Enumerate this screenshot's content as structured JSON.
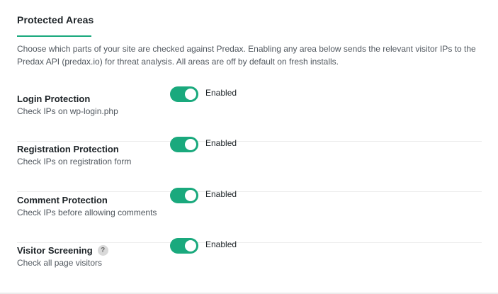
{
  "section": {
    "title": "Protected Areas",
    "description": "Choose which parts of your site are checked against Predax. Enabling any area below sends the relevant visitor IPs to the Predax API (predax.io) for threat analysis. All areas are off by default on fresh installs.",
    "accent_color": "#1aa97d"
  },
  "rows": [
    {
      "label": "Login Protection",
      "description": "Check IPs on wp-login.php",
      "toggle_state": "Enabled",
      "checked": true
    },
    {
      "label": "Registration Protection",
      "description": "Check IPs on registration form",
      "toggle_state": "Enabled",
      "checked": true
    },
    {
      "label": "Comment Protection",
      "description": "Check IPs before allowing comments",
      "toggle_state": "Enabled",
      "checked": true
    },
    {
      "label": "Visitor Screening",
      "description": "Check all page visitors",
      "toggle_state": "Enabled",
      "checked": true,
      "help_icon": "?"
    }
  ]
}
